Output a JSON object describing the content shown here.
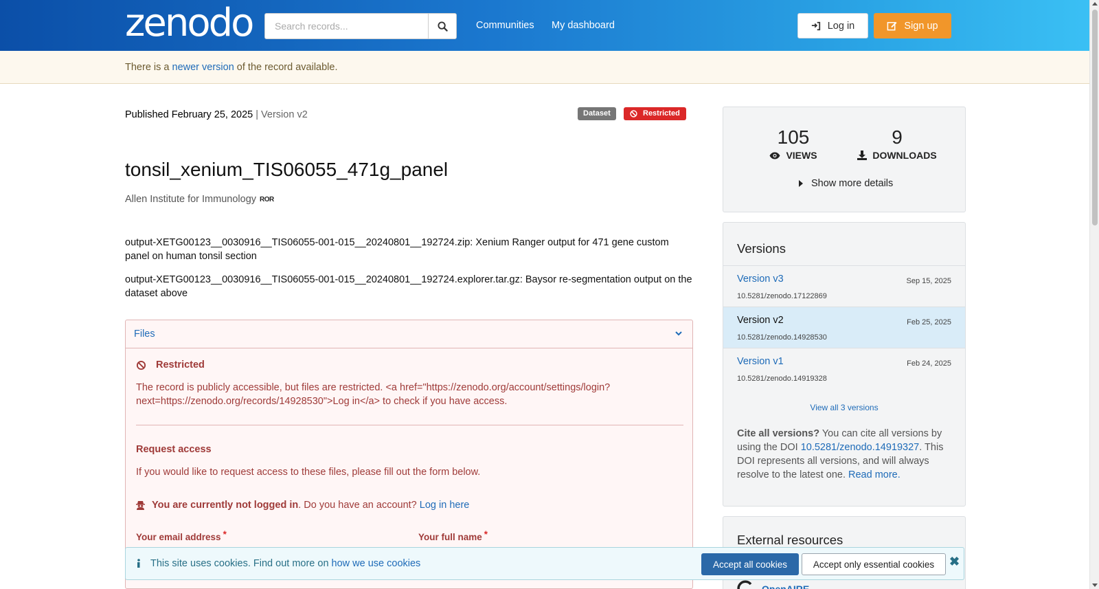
{
  "header": {
    "logo": "zenodo",
    "search_placeholder": "Search records...",
    "nav": [
      "Communities",
      "My dashboard"
    ],
    "login_label": "Log in",
    "signup_label": "Sign up"
  },
  "notice": {
    "before": "There is a ",
    "link": "newer version",
    "after": " of the record available."
  },
  "record": {
    "published": "Published February 25, 2025",
    "version": "| Version v2",
    "type_label": "Dataset",
    "access_label": "Restricted",
    "title": "tonsil_xenium_TIS06055_471g_panel",
    "creator": "Allen Institute for Immunology",
    "ror_label": "ROR",
    "description": [
      "output-XETG00123__0030916__TIS06055-001-015__20240801__192724.zip: Xenium Ranger output for 471 gene custom panel on human tonsil section",
      "output-XETG00123__0030916__TIS06055-001-015__20240801__192724.explorer.tar.gz: Baysor re-segmentation output on the dataset above"
    ]
  },
  "files": {
    "heading": "Files",
    "restricted_title": "Restricted",
    "restricted_message": "The record is publicly accessible, but files are restricted. <a href=\"https://zenodo.org/account/settings/login?next=https://zenodo.org/records/14928530\">Log in</a> to check if you have access.",
    "request_title": "Request access",
    "request_message": "If you would like to request access to these files, please fill out the form below.",
    "not_logged_bold": "You are currently not logged in",
    "not_logged_rest": ". Do you have an account? ",
    "login_here": "Log in here",
    "email_label": "Your email address",
    "name_label": "Your full name"
  },
  "stats": {
    "views": "105",
    "views_label": "VIEWS",
    "downloads": "9",
    "downloads_label": "DOWNLOADS",
    "more_details": "Show more details"
  },
  "versions": {
    "heading": "Versions",
    "items": [
      {
        "name": "Version v3",
        "date": "Sep 15, 2025",
        "doi": "10.5281/zenodo.17122869"
      },
      {
        "name": "Version v2",
        "date": "Feb 25, 2025",
        "doi": "10.5281/zenodo.14928530"
      },
      {
        "name": "Version v1",
        "date": "Feb 24, 2025",
        "doi": "10.5281/zenodo.14919328"
      }
    ],
    "view_all": "View all 3 versions",
    "cite_bold": "Cite all versions?",
    "cite_text1": " You can cite all versions by using the DOI ",
    "cite_doi": "10.5281/zenodo.14919327",
    "cite_text2": ". This DOI represents all versions, and will always resolve to the latest one. ",
    "read_more": "Read more."
  },
  "external": {
    "heading": "External resources",
    "openaire": "OpenAIRE"
  },
  "cookie": {
    "text": "This site uses cookies. Find out more on ",
    "link": "how we use cookies",
    "accept_all": "Accept all cookies",
    "accept_essential": "Accept only essential cookies"
  },
  "colors": {
    "brand_gradient_start": "#0b4fa8",
    "brand_gradient_end": "#3bc1f5",
    "signup": "#f1962a",
    "restricted": "#db2828",
    "link": "#1e6bb8"
  }
}
